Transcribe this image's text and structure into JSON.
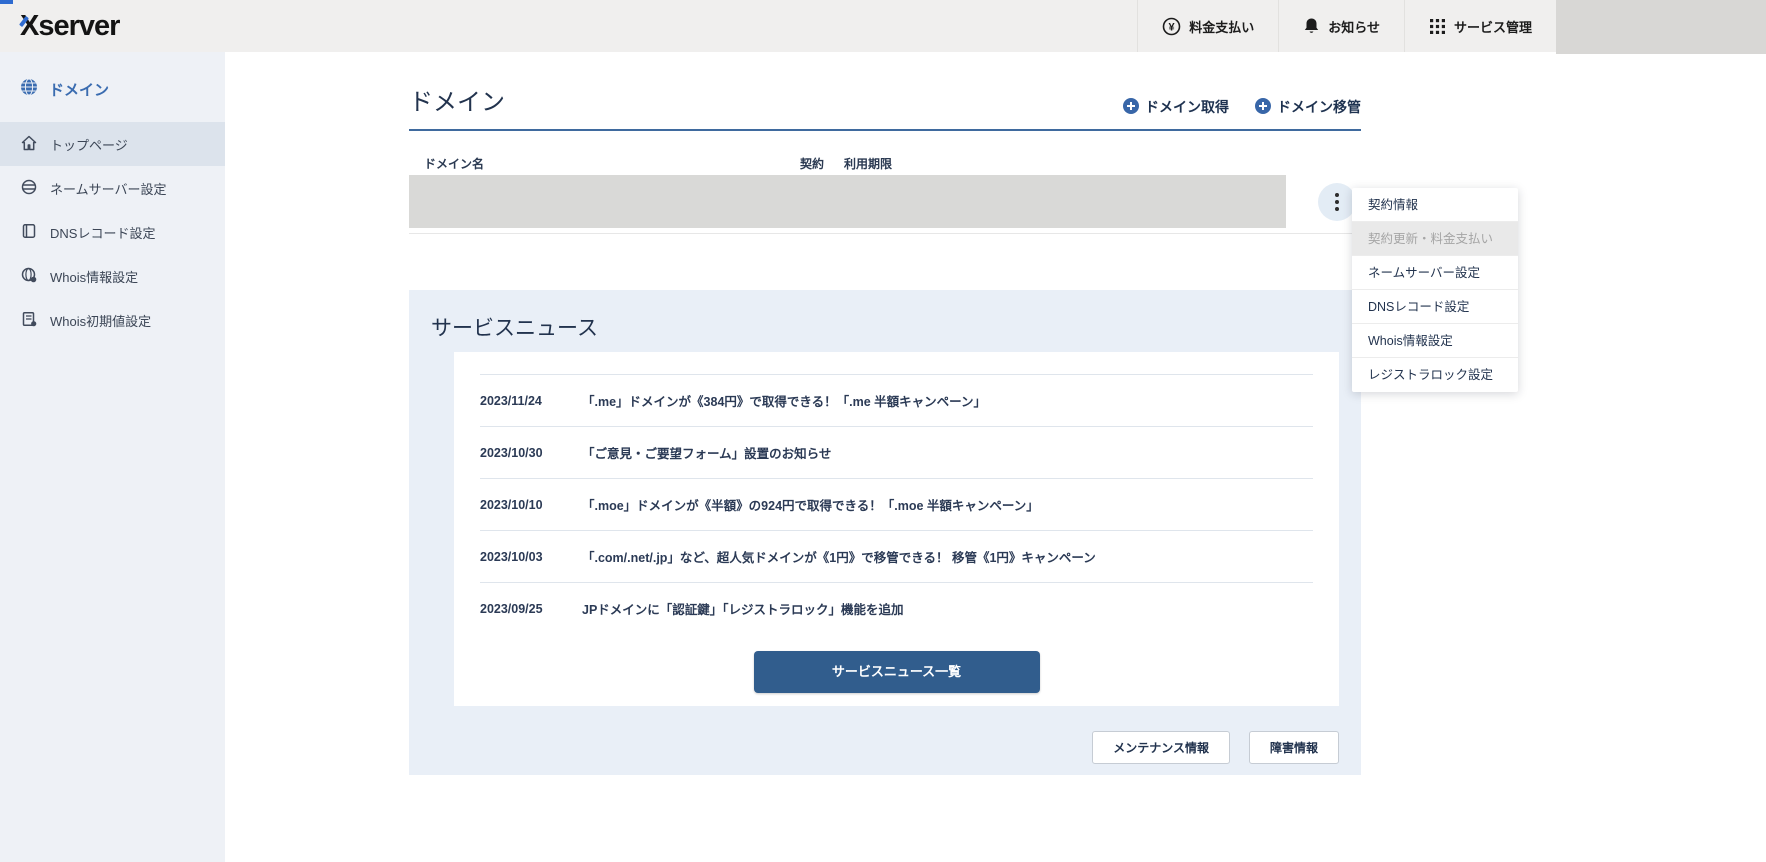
{
  "header": {
    "logo": "Xserver",
    "nav": [
      {
        "label": "料金支払い",
        "icon": "yen-circle-icon"
      },
      {
        "label": "お知らせ",
        "icon": "bell-icon"
      },
      {
        "label": "サービス管理",
        "icon": "grid-icon"
      }
    ]
  },
  "sidebar": {
    "section_label": "ドメイン",
    "items": [
      {
        "label": "トップページ",
        "active": true
      },
      {
        "label": "ネームサーバー設定",
        "active": false
      },
      {
        "label": "DNSレコード設定",
        "active": false
      },
      {
        "label": "Whois情報設定",
        "active": false
      },
      {
        "label": "Whois初期値設定",
        "active": false
      }
    ]
  },
  "main": {
    "title": "ドメイン",
    "actions": [
      {
        "label": "ドメイン取得"
      },
      {
        "label": "ドメイン移管"
      }
    ],
    "table": {
      "headers": [
        "ドメイン名",
        "契約",
        "利用期限"
      ]
    },
    "context_menu": {
      "items": [
        {
          "label": "契約情報",
          "disabled": false
        },
        {
          "label": "契約更新・料金支払い",
          "disabled": true
        },
        {
          "label": "ネームサーバー設定",
          "disabled": false
        },
        {
          "label": "DNSレコード設定",
          "disabled": false
        },
        {
          "label": "Whois情報設定",
          "disabled": false
        },
        {
          "label": "レジストラロック設定",
          "disabled": false
        }
      ]
    },
    "news": {
      "title": "サービスニュース",
      "items": [
        {
          "date": "2023/11/24",
          "text": "「.me」ドメインが《384円》で取得できる！「.me 半額キャンペーン」"
        },
        {
          "date": "2023/10/30",
          "text": "「ご意見・ご要望フォーム」設置のお知らせ"
        },
        {
          "date": "2023/10/10",
          "text": "「.moe」ドメインが《半額》の924円で取得できる！「.moe 半額キャンペーン」"
        },
        {
          "date": "2023/10/03",
          "text": "「.com/.net/.jp」など、超人気ドメインが《1円》で移管できる！ 移管《1円》キャンペーン"
        },
        {
          "date": "2023/09/25",
          "text": "JPドメインに「認証鍵」「レジストラロック」機能を追加"
        }
      ],
      "list_button_label": "サービスニュース一覧",
      "footer_buttons": [
        {
          "label": "メンテナンス情報"
        },
        {
          "label": "障害情報"
        }
      ]
    }
  },
  "colors": {
    "accent_blue": "#3a6cb0",
    "navy_text": "#22334e",
    "header_bg": "#f0efee",
    "sidebar_bg": "#eef1f6",
    "sidebar_active_bg": "#dce3ec",
    "news_section_bg": "#e9eff7",
    "primary_button_bg": "#315d8d",
    "redacted_gray": "#d9d8d6",
    "disabled_item_bg": "#e9e9e9"
  }
}
